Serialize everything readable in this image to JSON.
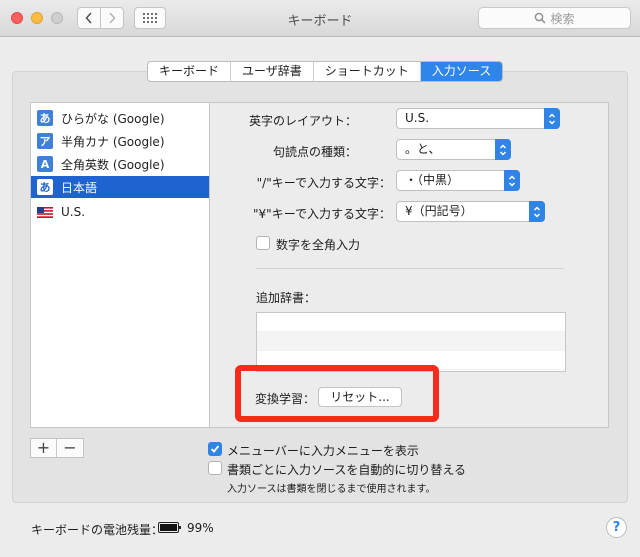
{
  "window": {
    "title": "キーボード"
  },
  "search": {
    "placeholder": "検索"
  },
  "tabs": [
    {
      "label": "キーボード",
      "active": false
    },
    {
      "label": "ユーザ辞書",
      "active": false
    },
    {
      "label": "ショートカット",
      "active": false
    },
    {
      "label": "入力ソース",
      "active": true
    }
  ],
  "sources": [
    {
      "icon": "あ",
      "label": "ひらがな (Google)",
      "selected": false
    },
    {
      "icon": "ア",
      "label": "半角カナ (Google)",
      "selected": false
    },
    {
      "icon": "A",
      "label": "全角英数 (Google)",
      "selected": false
    },
    {
      "icon": "あ",
      "label": "日本語",
      "selected": true
    },
    {
      "icon": "us-flag-icon",
      "label": "U.S.",
      "selected": false
    }
  ],
  "settings": {
    "layout_label": "英字のレイアウト：",
    "layout_value": "U.S.",
    "punct_label": "句読点の種類：",
    "punct_value": "。と、",
    "slash_label": "\"/\"キーで入力する文字：",
    "slash_value": "・（中黒）",
    "yen_label": "\"¥\"キーで入力する文字：",
    "yen_value": "¥（円記号）",
    "fullwidth_numbers_label": "数字を全角入力",
    "fullwidth_numbers_checked": false,
    "dict_label": "追加辞書：",
    "learning_label": "変換学習：",
    "reset_label": "リセット..."
  },
  "list_buttons": {
    "add": "+",
    "remove": "−"
  },
  "options": {
    "show_menu_label": "メニューバーに入力メニューを表示",
    "show_menu_checked": true,
    "auto_switch_label": "書類ごとに入力ソースを自動的に切り替える",
    "auto_switch_checked": false,
    "note": "入力ソースは書類を閉じるまで使用されます。"
  },
  "status": {
    "battery_label": "キーボードの電池残量：",
    "battery_percent": "99%",
    "help": "?"
  },
  "colors": {
    "accent": "#2f84e6",
    "highlight": "#f62b1b"
  }
}
